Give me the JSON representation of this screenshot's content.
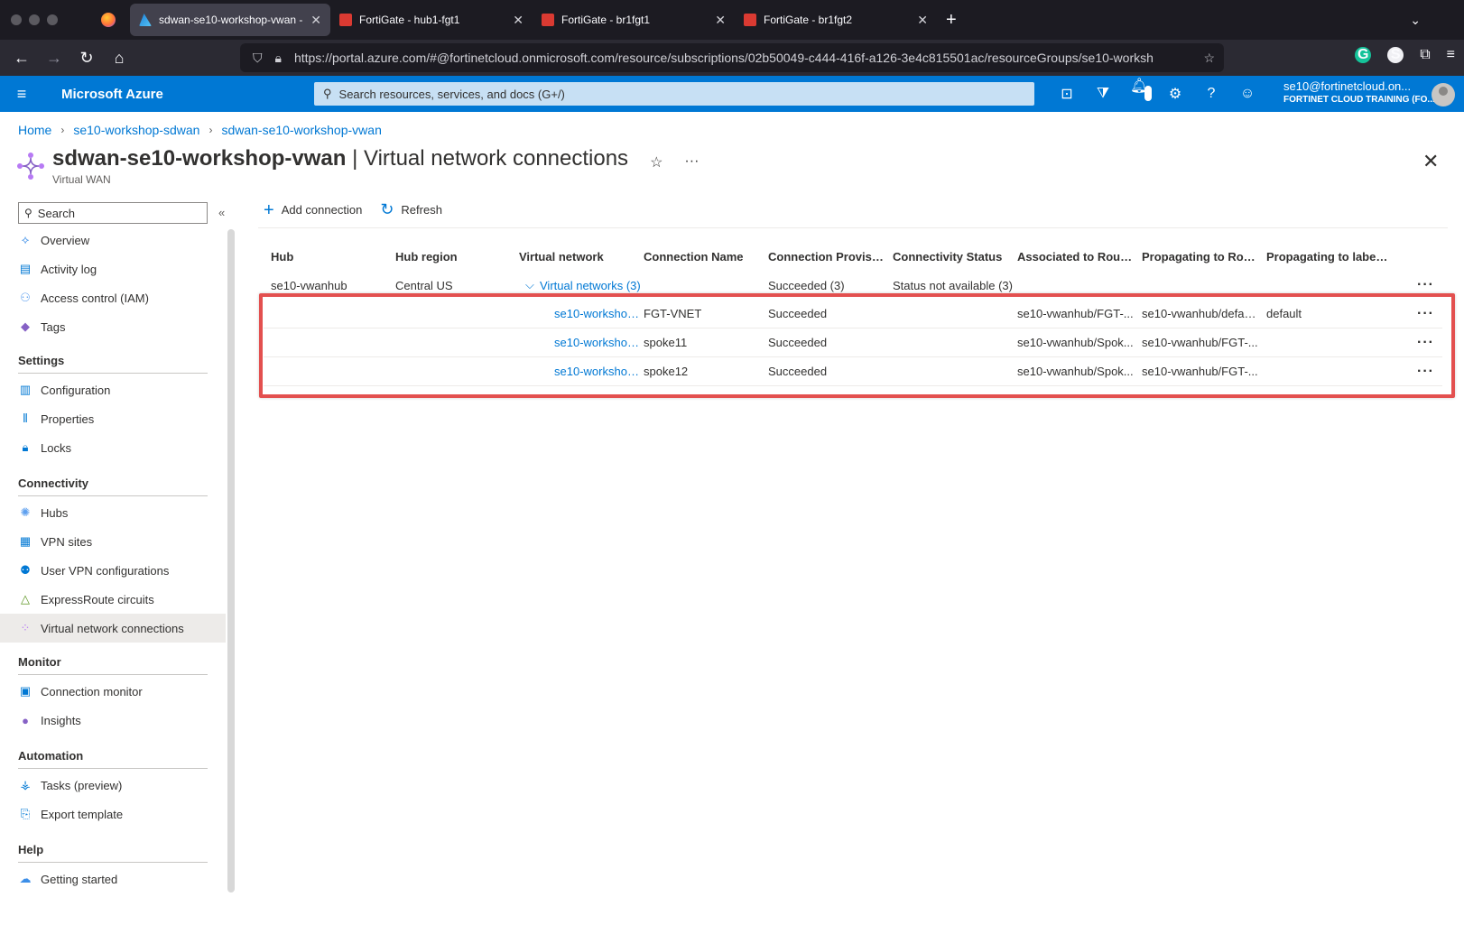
{
  "browser": {
    "tabs": [
      {
        "title": "sdwan-se10-workshop-vwan - M",
        "active": true,
        "favicon": "azure-icon"
      },
      {
        "title": "FortiGate - hub1-fgt1",
        "active": false,
        "favicon": "fortigate-icon"
      },
      {
        "title": "FortiGate - br1fgt1",
        "active": false,
        "favicon": "fortigate-icon"
      },
      {
        "title": "FortiGate - br1fgt2",
        "active": false,
        "favicon": "fortigate-icon"
      }
    ],
    "url": "https://portal.azure.com/#@fortinetcloud.onmicrosoft.com/resource/subscriptions/02b50049-c444-416f-a126-3e4c815501ac/resourceGroups/se10-worksh"
  },
  "azure": {
    "brand": "Microsoft Azure",
    "search_placeholder": "Search resources, services, and docs (G+/)",
    "notifications_count": "5",
    "account_email": "se10@fortinetcloud.on...",
    "account_org": "FORTINET CLOUD TRAINING (FO..."
  },
  "breadcrumb": [
    "Home",
    "se10-workshop-sdwan",
    "sdwan-se10-workshop-vwan"
  ],
  "page": {
    "title_resource": "sdwan-se10-workshop-vwan",
    "title_sep": " | ",
    "title_blade": "Virtual network connections",
    "subtitle": "Virtual WAN"
  },
  "sidebar": {
    "search_placeholder": "Search",
    "top_items": [
      "Overview",
      "Activity log",
      "Access control (IAM)",
      "Tags"
    ],
    "groups": [
      {
        "name": "Settings",
        "items": [
          "Configuration",
          "Properties",
          "Locks"
        ]
      },
      {
        "name": "Connectivity",
        "items": [
          "Hubs",
          "VPN sites",
          "User VPN configurations",
          "ExpressRoute circuits",
          "Virtual network connections"
        ]
      },
      {
        "name": "Monitor",
        "items": [
          "Connection monitor",
          "Insights"
        ]
      },
      {
        "name": "Automation",
        "items": [
          "Tasks (preview)",
          "Export template"
        ]
      },
      {
        "name": "Help",
        "items": [
          "Getting started"
        ]
      }
    ],
    "selected": "Virtual network connections"
  },
  "toolbar": {
    "add_connection": "Add connection",
    "refresh": "Refresh"
  },
  "table": {
    "columns": [
      "Hub",
      "Hub region",
      "Virtual network",
      "Connection Name",
      "Connection Provisio...",
      "Connectivity Status",
      "Associated to Route...",
      "Propagating to Rou...",
      "Propagating to label..."
    ],
    "group_row": {
      "hub": "se10-vwanhub",
      "region": "Central US",
      "vnet_group": "Virtual networks (3)",
      "provisioning": "Succeeded (3)",
      "status": "Status not available (3)"
    },
    "rows": [
      {
        "vnet": "se10-workshop...",
        "name": "FGT-VNET",
        "provisioning": "Succeeded",
        "associated": "se10-vwanhub/FGT-...",
        "propagating": "se10-vwanhub/defau...",
        "labels": "default"
      },
      {
        "vnet": "se10-workshop...",
        "name": "spoke11",
        "provisioning": "Succeeded",
        "associated": "se10-vwanhub/Spok...",
        "propagating": "se10-vwanhub/FGT-...",
        "labels": ""
      },
      {
        "vnet": "se10-workshop...",
        "name": "spoke12",
        "provisioning": "Succeeded",
        "associated": "se10-vwanhub/Spok...",
        "propagating": "se10-vwanhub/FGT-...",
        "labels": ""
      }
    ]
  },
  "colors": {
    "accent": "#0078d4",
    "highlight": "#e3504f",
    "browser_dark": "#1c1b22"
  }
}
